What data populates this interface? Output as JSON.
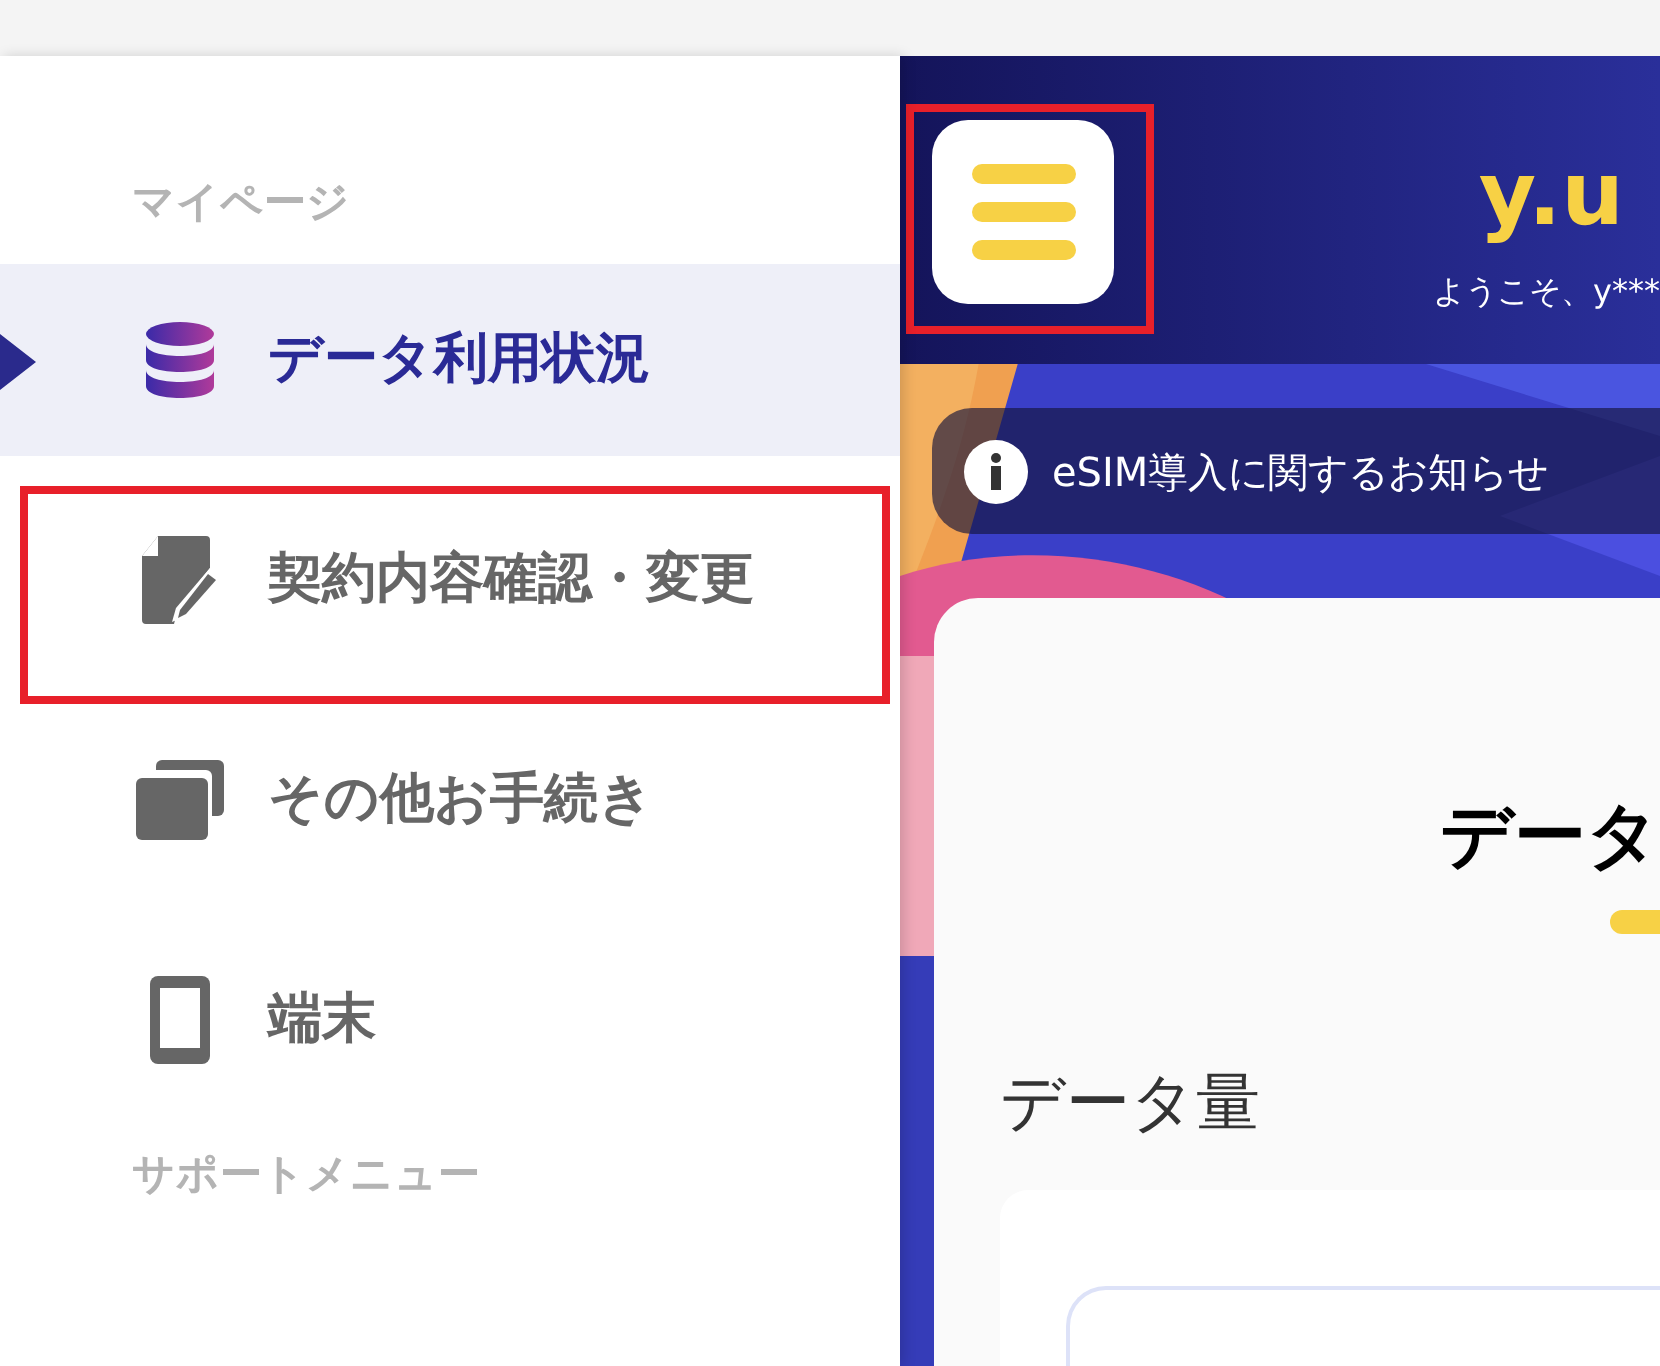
{
  "sidebar": {
    "sections": [
      {
        "heading": "マイページ",
        "items": [
          {
            "label": "データ利用状況",
            "selected": true,
            "highlighted": false
          },
          {
            "label": "契約内容確認・変更",
            "selected": false,
            "highlighted": true
          },
          {
            "label": "その他お手続き",
            "selected": false,
            "highlighted": false
          },
          {
            "label": "端末",
            "selected": false,
            "highlighted": false
          }
        ]
      },
      {
        "heading": "サポートメニュー"
      }
    ]
  },
  "header": {
    "menu_button": {
      "highlighted": true
    },
    "logo": "y.u",
    "welcome": "ようこそ、y***"
  },
  "notice": {
    "text": "eSIM導入に関するお知らせ"
  },
  "card": {
    "title": "データ",
    "section_title": "データ量"
  }
}
